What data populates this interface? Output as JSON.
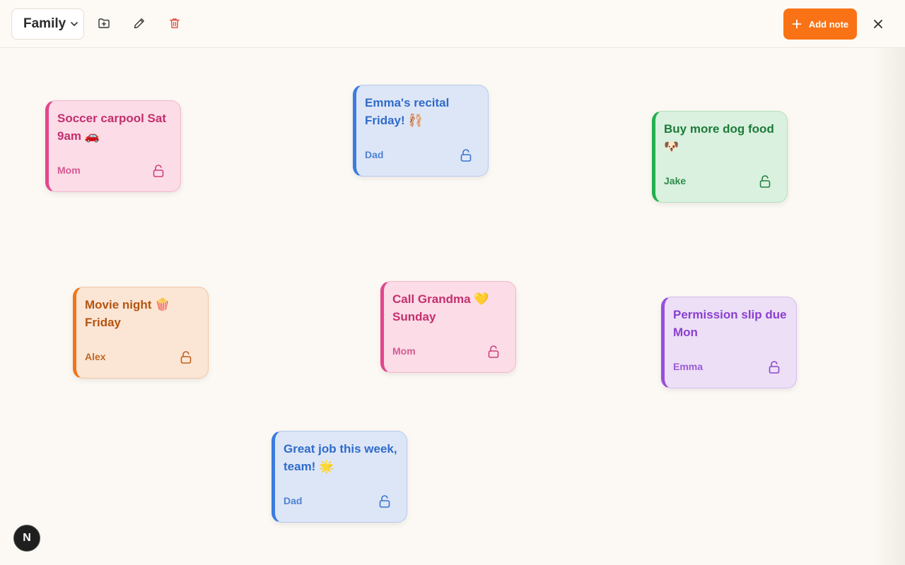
{
  "toolbar": {
    "board_select_value": "Family",
    "add_note_label": "Add note",
    "icons": {
      "new_folder": "folder-plus-icon",
      "rename": "pencil-icon",
      "delete": "trash-icon",
      "add": "plus-icon",
      "close": "close-icon",
      "dropdown": "chevron-down-icon"
    },
    "accent_color": "#f97316",
    "delete_color": "#e14a3a"
  },
  "notes": [
    {
      "text": "Soccer carpool Sat 9am 🚗",
      "author": "Mom",
      "color": "pink",
      "locked": false
    },
    {
      "text": "Emma's recital Friday! 🩰",
      "author": "Dad",
      "color": "blue",
      "locked": false
    },
    {
      "text": "Buy more dog food 🐶",
      "author": "Jake",
      "color": "green",
      "locked": false
    },
    {
      "text": "Movie night 🍿 Friday",
      "author": "Alex",
      "color": "orange",
      "locked": false
    },
    {
      "text": "Call Grandma 💛 Sunday",
      "author": "Mom",
      "color": "pink",
      "locked": false
    },
    {
      "text": "Permission slip due Mon",
      "author": "Emma",
      "color": "purple",
      "locked": false
    },
    {
      "text": "Great job this week, team! 🌟",
      "author": "Dad",
      "color": "blue",
      "locked": false
    }
  ],
  "colors": {
    "pink": "#e2468b",
    "blue": "#3b7be0",
    "green": "#22b04c",
    "orange": "#f07518",
    "purple": "#9a4fdc"
  },
  "badge": {
    "label": "N"
  }
}
